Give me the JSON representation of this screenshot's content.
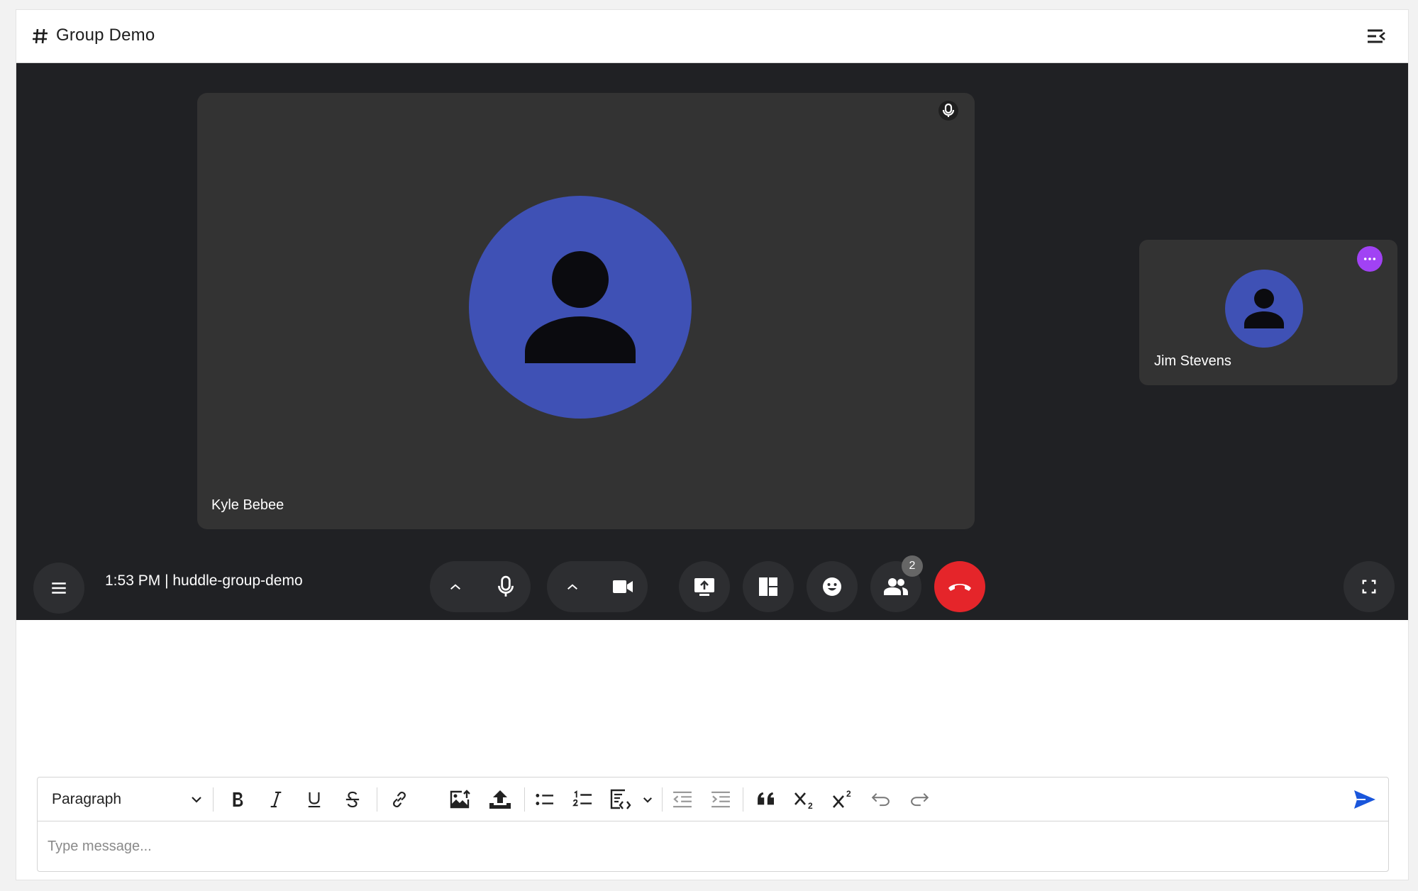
{
  "header": {
    "channel_name": "Group Demo"
  },
  "call": {
    "main_participant": {
      "name": "Kyle Bebee",
      "avatar_color": "#3f51b5"
    },
    "side_participant": {
      "name": "Jim Stevens",
      "avatar_color": "#3f51b5"
    },
    "meeting_time": "1:53 PM",
    "meeting_code": "huddle-group-demo",
    "participant_count": "2",
    "colors": {
      "background": "#202124",
      "tile": "#333333",
      "hangup": "#e5252a",
      "more_badge": "#a142f4"
    }
  },
  "editor": {
    "block_type": "Paragraph",
    "placeholder": "Type message...",
    "value": "",
    "send_color": "#1a56db"
  },
  "icons": [
    "hash-icon",
    "sidebar-toggle-icon",
    "mic-icon",
    "menu-icon",
    "chevron-up-icon",
    "camera-icon",
    "present-icon",
    "layout-icon",
    "emoji-icon",
    "people-icon",
    "hangup-icon",
    "fullscreen-icon",
    "bold-icon",
    "italic-icon",
    "underline-icon",
    "strikethrough-icon",
    "link-icon",
    "image-icon",
    "upload-icon",
    "bullet-list-icon",
    "numbered-list-icon",
    "code-block-icon",
    "outdent-icon",
    "indent-icon",
    "quote-icon",
    "subscript-icon",
    "superscript-icon",
    "undo-icon",
    "redo-icon",
    "send-icon"
  ]
}
